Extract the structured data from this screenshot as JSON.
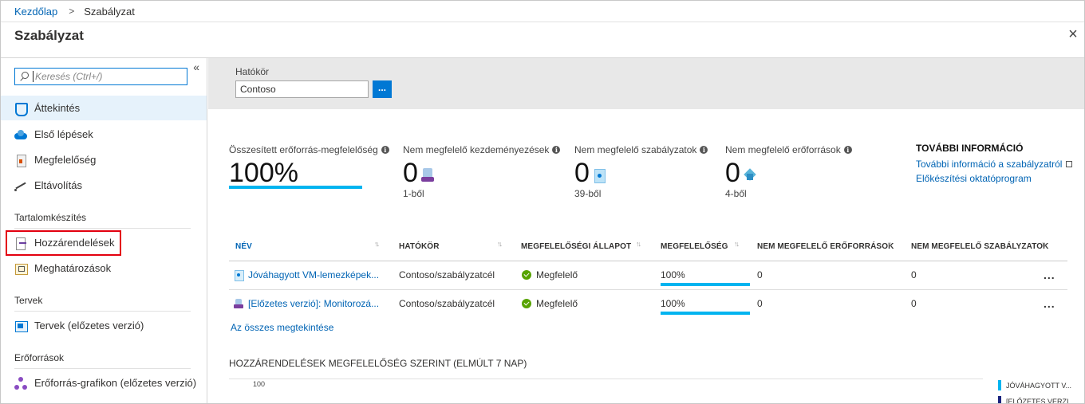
{
  "breadcrumb": {
    "home": "Kezdőlap",
    "separator": ">",
    "current": "Szabályzat"
  },
  "page": {
    "title": "Szabályzat",
    "close_icon": "×"
  },
  "sidebar": {
    "collapse_icon": "«",
    "search_placeholder": "Keresés (Ctrl+/)",
    "items_top": [
      {
        "label": "Áttekintés",
        "icon": "shield-icon",
        "active": true
      },
      {
        "label": "Első lépések",
        "icon": "cloud-icon"
      },
      {
        "label": "Megfelelőség",
        "icon": "document-icon"
      },
      {
        "label": "Eltávolítás",
        "icon": "trend-icon"
      }
    ],
    "section_authoring": "Tartalomkészítés",
    "items_authoring": [
      {
        "label": "Hozzárendelések",
        "icon": "assignment-icon",
        "highlighted": true
      },
      {
        "label": "Meghatározások",
        "icon": "definition-icon"
      }
    ],
    "section_blueprints": "Tervek",
    "items_blueprints": [
      {
        "label": "Tervek (előzetes verzió)",
        "icon": "blueprint-icon"
      }
    ],
    "section_resources": "Erőforrások",
    "items_resources": [
      {
        "label": "Erőforrás-grafikon (előzetes verzió)",
        "icon": "resource-graph-icon"
      }
    ]
  },
  "scope": {
    "label": "Hatókör",
    "value": "Contoso",
    "button": "..."
  },
  "kpis": [
    {
      "label": "Összesített erőforrás-megfelelőség",
      "value": "100%",
      "sub": "",
      "progress_percent": 100
    },
    {
      "label": "Nem megfelelő kezdeményezések",
      "value": "0",
      "sub": "1-ből",
      "icon": "initiative-icon"
    },
    {
      "label": "Nem megfelelő szabályzatok",
      "value": "0",
      "sub": "39-ből",
      "icon": "policy-icon"
    },
    {
      "label": "Nem megfelelő erőforrások",
      "value": "0",
      "sub": "4-ből",
      "icon": "resource-cube-icon"
    }
  ],
  "more_info": {
    "title": "TOVÁBBI INFORMÁCIÓ",
    "links": [
      "További információ a szabályzatról",
      "Előkészítési oktatóprogram"
    ]
  },
  "table": {
    "columns": [
      "NÉV",
      "HATÓKÖR",
      "MEGFELELŐSÉGI ÁLLAPOT",
      "MEGFELELŐSÉG",
      "NEM MEGFELELŐ ERŐFORRÁSOK",
      "NEM MEGFELELŐ SZABÁLYZATOK"
    ],
    "sort_icon": "↑↓",
    "rows": [
      {
        "name": "Jóváhagyott VM-lemezképek...",
        "icon": "policy-icon",
        "scope": "Contoso/szabályzatcél",
        "status": "Megfelelő",
        "compliance": "100%",
        "compliance_percent": 100,
        "noncompliant_resources": "0",
        "noncompliant_policies": "0",
        "menu": "..."
      },
      {
        "name": "[Előzetes verzió]: Monitorozá...",
        "icon": "initiative-icon",
        "scope": "Contoso/szabályzatcél",
        "status": "Megfelelő",
        "compliance": "100%",
        "compliance_percent": 100,
        "noncompliant_resources": "0",
        "noncompliant_policies": "0",
        "menu": "..."
      }
    ],
    "see_all": "Az összes megtekintése"
  },
  "chart_data": {
    "type": "line",
    "title": "HOZZÁRENDELÉSEK MEGFELELŐSÉG SZERINT (ELMÚLT 7 NAP)",
    "y_ticks": [
      "100"
    ],
    "series": [
      {
        "name": "JÓVÁHAGYOTT V...",
        "color": "#00b4f0"
      },
      {
        "name": "[ELŐZETES VERZI...",
        "color": "#1a237e"
      }
    ]
  },
  "colors": {
    "accent": "#0078d4",
    "link": "#0064b4",
    "progress": "#00b4f0",
    "ok": "#57a300",
    "highlight": "#e3000f"
  }
}
